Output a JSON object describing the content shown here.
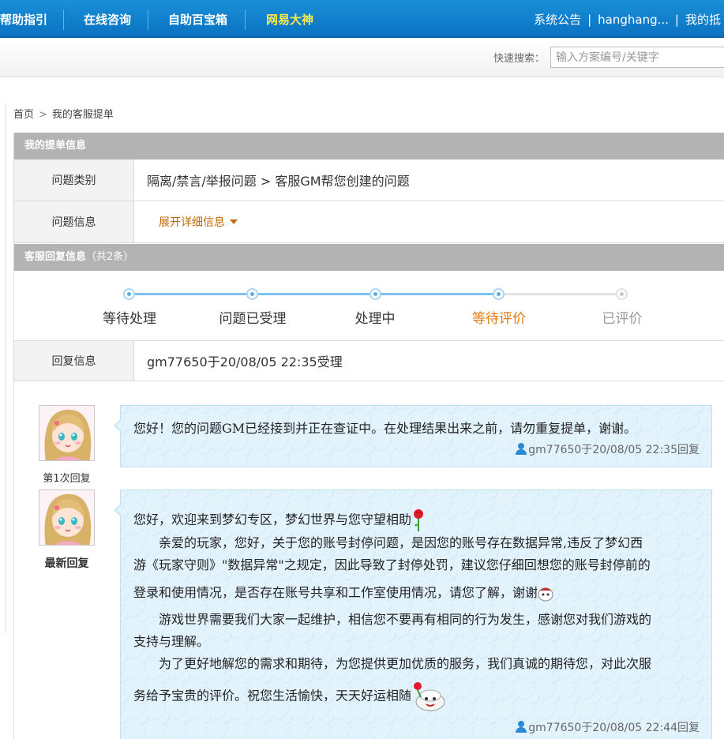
{
  "topnav": {
    "items": [
      "帮助指引",
      "在线咨询",
      "自助百宝箱",
      "网易大神"
    ],
    "right": {
      "announcement": "系统公告",
      "divider": "|",
      "user": "hanghang...",
      "my": "我的抵"
    }
  },
  "search": {
    "label": "快速搜索：",
    "placeholder": "输入方案编号/关键字"
  },
  "breadcrumb": {
    "home": "首页",
    "current": "我的客服提单"
  },
  "ticket": {
    "section_title": "我的提单信息",
    "category_label": "问题类别",
    "category_value": "隔离/禁言/举报问题 > 客服GM帮您创建的问题",
    "info_label": "问题信息",
    "expand_label": "展开详细信息"
  },
  "replies_section": {
    "title": "客服回复信息",
    "count": "（共2条）"
  },
  "progress": {
    "steps": [
      {
        "label": "等待处理",
        "state": "done"
      },
      {
        "label": "问题已受理",
        "state": "done"
      },
      {
        "label": "处理中",
        "state": "done"
      },
      {
        "label": "等待评价",
        "state": "current"
      },
      {
        "label": "已评价",
        "state": "future"
      }
    ]
  },
  "reply_info": {
    "label": "回复信息",
    "value": "gm77650于20/08/05 22:35受理"
  },
  "replies": [
    {
      "tag": "第1次回复",
      "lines": [
        "您好！您的问题GM已经接到并正在查证中。在处理结果出来之前，请勿重复提单，谢谢。"
      ],
      "author": "gm77650于20/08/05 22:35回复"
    },
    {
      "tag": "最新回复",
      "lines": [
        "您好，欢迎来到梦幻专区，梦幻世界与您守望相助",
        "　　亲爱的玩家，您好，关于您的账号封停问题，是因您的账号存在数据异常,违反了梦幻西",
        "游《玩家守则》\"数据异常\"之规定，因此导致了封停处罚，建议您仔细回想您的账号封停前的",
        "登录和使用情况，是否存在账号共享和工作室使用情况，请您了解，谢谢",
        "　　游戏世界需要我们大家一起维护，相信您不要再有相同的行为发生，感谢您对我们游戏的",
        "支持与理解。",
        "　　为了更好地解您的需求和期待，为您提供更加优质的服务，我们真诚的期待您，对此次服",
        "务给予宝贵的评价。祝您生活愉快，天天好运相随"
      ],
      "author": "gm77650于20/08/05 22:44回复"
    }
  ]
}
